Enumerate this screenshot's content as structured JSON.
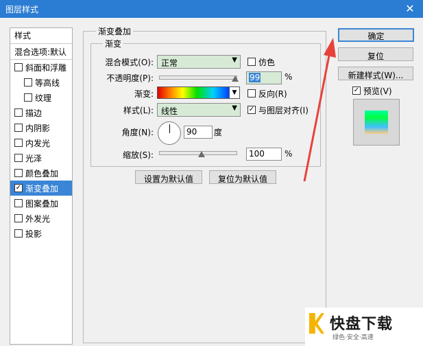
{
  "window": {
    "title": "图层样式",
    "close_glyph": "✕"
  },
  "styles_panel": {
    "header": "样式",
    "blend_options": "混合选项:默认",
    "items": [
      {
        "label": "斜面和浮雕",
        "checked": false,
        "indent": false,
        "selected": false
      },
      {
        "label": "等高线",
        "checked": false,
        "indent": true,
        "selected": false
      },
      {
        "label": "纹理",
        "checked": false,
        "indent": true,
        "selected": false
      },
      {
        "label": "描边",
        "checked": false,
        "indent": false,
        "selected": false
      },
      {
        "label": "内阴影",
        "checked": false,
        "indent": false,
        "selected": false
      },
      {
        "label": "内发光",
        "checked": false,
        "indent": false,
        "selected": false
      },
      {
        "label": "光泽",
        "checked": false,
        "indent": false,
        "selected": false
      },
      {
        "label": "颜色叠加",
        "checked": false,
        "indent": false,
        "selected": false
      },
      {
        "label": "渐变叠加",
        "checked": true,
        "indent": false,
        "selected": true
      },
      {
        "label": "图案叠加",
        "checked": false,
        "indent": false,
        "selected": false
      },
      {
        "label": "外发光",
        "checked": false,
        "indent": false,
        "selected": false
      },
      {
        "label": "投影",
        "checked": false,
        "indent": false,
        "selected": false
      }
    ]
  },
  "gradient_overlay": {
    "group_title": "渐变叠加",
    "inner_title": "渐变",
    "blend_mode": {
      "label": "混合模式(O):",
      "value": "正常"
    },
    "dither": {
      "label": "仿色",
      "checked": false
    },
    "opacity": {
      "label": "不透明度(P):",
      "value": "99",
      "unit": "%",
      "level": 0.99
    },
    "gradient": {
      "label": "渐变:"
    },
    "reverse": {
      "label": "反向(R)",
      "checked": false
    },
    "style": {
      "label": "样式(L):",
      "value": "线性"
    },
    "align": {
      "label": "与图层对齐(I)",
      "checked": true
    },
    "angle": {
      "label": "角度(N):",
      "value": "90",
      "unit": "度"
    },
    "scale": {
      "label": "缩放(S):",
      "value": "100",
      "unit": "%",
      "level": 0.55
    },
    "make_default": "设置为默认值",
    "reset_default": "复位为默认值"
  },
  "right_buttons": {
    "ok": "确定",
    "reset": "复位",
    "new_style": "新建样式(W)...",
    "preview": {
      "label": "预览(V)",
      "checked": true
    }
  },
  "watermark": {
    "main": "快盘下载",
    "sub": "绿色·安全·高速"
  },
  "colors": {
    "title_bar": "#2b7cd3",
    "selection": "#3a85d6",
    "arrow": "#e8413a"
  }
}
